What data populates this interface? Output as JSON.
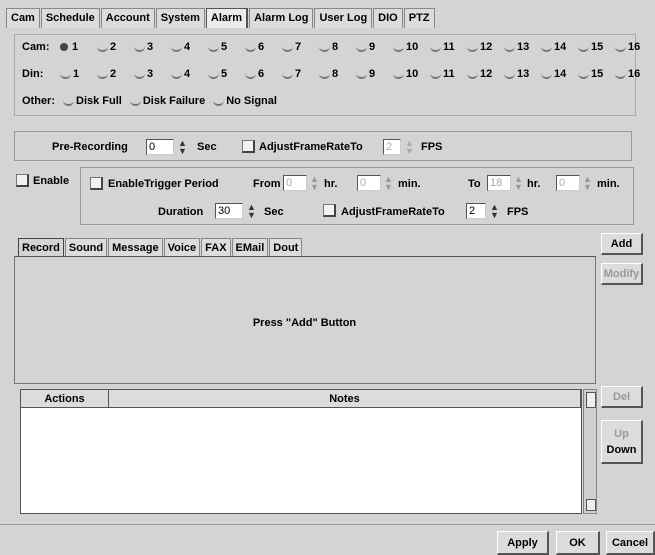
{
  "top_tabs": [
    {
      "label": "Cam"
    },
    {
      "label": "Schedule"
    },
    {
      "label": "Account"
    },
    {
      "label": "System"
    },
    {
      "label": "Alarm",
      "active": true
    },
    {
      "label": "Alarm Log"
    },
    {
      "label": "User Log"
    },
    {
      "label": "DIO"
    },
    {
      "label": "PTZ"
    }
  ],
  "selector": {
    "cam_label": "Cam:",
    "din_label": "Din:",
    "other_label": "Other:",
    "numbers": [
      "1",
      "2",
      "3",
      "4",
      "5",
      "6",
      "7",
      "8",
      "9",
      "10",
      "11",
      "12",
      "13",
      "14",
      "15",
      "16"
    ],
    "selected_cam": "1",
    "other_items": [
      "Disk Full",
      "Disk Failure",
      "No Signal"
    ]
  },
  "prerec": {
    "label": "Pre-Recording",
    "value": "0",
    "unit": "Sec",
    "adjust_label": "AdjustFrameRateTo",
    "adjust_value": "2",
    "adjust_unit": "FPS"
  },
  "trigger": {
    "enable_label": "Enable",
    "period_label": "EnableTrigger Period",
    "from_label": "From",
    "from_hr": "0",
    "hr_label": "hr.",
    "from_min": "0",
    "min_label": "min.",
    "to_label": "To",
    "to_hr": "18",
    "to_min": "0",
    "duration_label": "Duration",
    "duration_value": "30",
    "duration_unit": "Sec",
    "adjust_label": "AdjustFrameRateTo",
    "adjust_value": "2",
    "adjust_unit": "FPS"
  },
  "action_tabs": [
    {
      "label": "Record",
      "active": true
    },
    {
      "label": "Sound"
    },
    {
      "label": "Message"
    },
    {
      "label": "Voice"
    },
    {
      "label": "FAX"
    },
    {
      "label": "EMail"
    },
    {
      "label": "Dout"
    }
  ],
  "action_panel_text": "Press \"Add\" Button",
  "side_buttons": {
    "add": "Add",
    "modify": "Modify",
    "del": "Del",
    "up": "Up",
    "down": "Down"
  },
  "table": {
    "headers": [
      "Actions",
      "Notes"
    ]
  },
  "bottom_buttons": {
    "apply": "Apply",
    "ok": "OK",
    "cancel": "Cancel"
  }
}
